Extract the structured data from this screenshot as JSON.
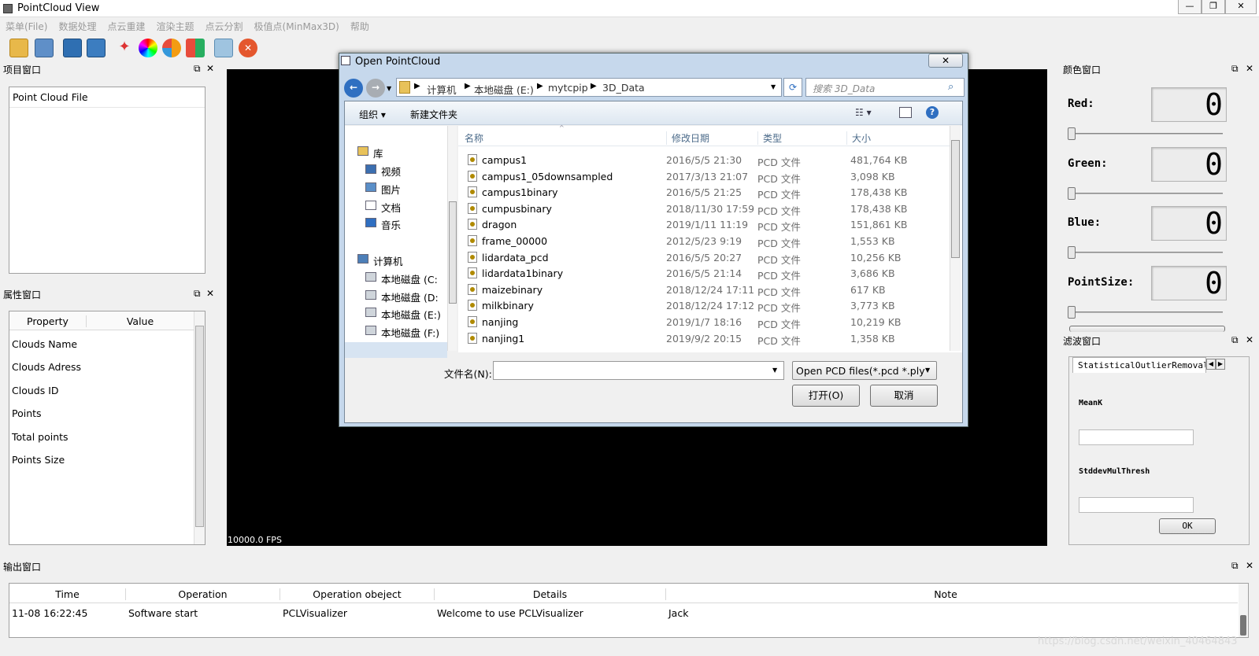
{
  "window": {
    "title": "PointCloud View",
    "min": "—",
    "max": "❐",
    "close": "✕"
  },
  "menu": [
    "菜单(File)",
    "数据处理",
    "点云重建",
    "渲染主题",
    "点云分割",
    "极值点(MinMax3D)",
    "帮助"
  ],
  "toolbar_icons": [
    "open-file-icon",
    "open-folder-icon",
    "save-icon",
    "save-as-icon",
    "magic-wand-icon",
    "color-wheel-icon",
    "color-ball-icon",
    "windows-theme-icon",
    "clear-icon",
    "exit-icon"
  ],
  "project_panel": {
    "title": "项目窗口",
    "header": "Point Cloud File"
  },
  "property_panel": {
    "title": "属性窗口",
    "columns": [
      "Property",
      "Value"
    ],
    "rows": [
      "Clouds Name",
      "Clouds Adress",
      "Clouds ID",
      "Points",
      "Total points",
      "Points Size"
    ]
  },
  "viewer": {
    "fps": "10000.0 FPS"
  },
  "color_panel": {
    "title": "颜色窗口",
    "items": [
      {
        "label": "Red:",
        "value": "0"
      },
      {
        "label": "Green:",
        "value": "0"
      },
      {
        "label": "Blue:",
        "value": "0"
      },
      {
        "label": "PointSize:",
        "value": "0"
      }
    ]
  },
  "filter_panel": {
    "title": "滤波窗口",
    "tab": "StatisticalOutlierRemoval",
    "meank_label": "MeanK",
    "stddev_label": "StddevMulThresh",
    "ok": "OK"
  },
  "output_panel": {
    "title": "输出窗口",
    "columns": [
      "Time",
      "Operation",
      "Operation obeject",
      "Details",
      "Note"
    ],
    "rows": [
      [
        "11-08 16:22:45",
        "Software start",
        "PCLVisualizer",
        "Welcome to use PCLVisualizer",
        "Jack"
      ]
    ]
  },
  "watermark": "https://blog.csdn.net/weixin_40464843",
  "dialog": {
    "title": "Open PointCloud",
    "close": "✕",
    "breadcrumb": [
      "计算机",
      "本地磁盘 (E:)",
      "mytcpip",
      "3D_Data"
    ],
    "search_placeholder": "搜索 3D_Data",
    "organize": "组织 ▾",
    "new_folder": "新建文件夹",
    "nav": [
      {
        "label": "库",
        "icon": "library-icon",
        "indent": 0
      },
      {
        "label": "视频",
        "icon": "video-icon",
        "indent": 1
      },
      {
        "label": "图片",
        "icon": "picture-icon",
        "indent": 1
      },
      {
        "label": "文档",
        "icon": "document-icon",
        "indent": 1
      },
      {
        "label": "音乐",
        "icon": "music-icon",
        "indent": 1
      },
      {
        "label": "计算机",
        "icon": "computer-icon",
        "indent": 0
      },
      {
        "label": "本地磁盘 (C:",
        "icon": "disk-icon",
        "indent": 1
      },
      {
        "label": "本地磁盘 (D:",
        "icon": "disk-icon",
        "indent": 1
      },
      {
        "label": "本地磁盘 (E:)",
        "icon": "disk-icon",
        "indent": 1
      },
      {
        "label": "本地磁盘 (F:)",
        "icon": "disk-icon",
        "indent": 1
      }
    ],
    "columns": [
      "名称",
      "修改日期",
      "类型",
      "大小"
    ],
    "files": [
      [
        "campus1",
        "2016/5/5 21:30",
        "PCD 文件",
        "481,764 KB"
      ],
      [
        "campus1_05downsampled",
        "2017/3/13 21:07",
        "PCD 文件",
        "3,098 KB"
      ],
      [
        "campus1binary",
        "2016/5/5 21:25",
        "PCD 文件",
        "178,438 KB"
      ],
      [
        "cumpusbinary",
        "2018/11/30 17:59",
        "PCD 文件",
        "178,438 KB"
      ],
      [
        "dragon",
        "2019/1/11 11:19",
        "PCD 文件",
        "151,861 KB"
      ],
      [
        "frame_00000",
        "2012/5/23 9:19",
        "PCD 文件",
        "1,553 KB"
      ],
      [
        "lidardata_pcd",
        "2016/5/5 20:27",
        "PCD 文件",
        "10,256 KB"
      ],
      [
        "lidardata1binary",
        "2016/5/5 21:14",
        "PCD 文件",
        "3,686 KB"
      ],
      [
        "maizebinary",
        "2018/12/24 17:11",
        "PCD 文件",
        "617 KB"
      ],
      [
        "milkbinary",
        "2018/12/24 17:12",
        "PCD 文件",
        "3,773 KB"
      ],
      [
        "nanjing",
        "2019/1/7 18:16",
        "PCD 文件",
        "10,219 KB"
      ],
      [
        "nanjing1",
        "2019/9/2 20:15",
        "PCD 文件",
        "1,358 KB"
      ]
    ],
    "filename_label": "文件名(N):",
    "filename_value": "",
    "filetype": "Open PCD files(*.pcd *.ply *.",
    "open_btn": "打开(O)",
    "cancel_btn": "取消"
  }
}
